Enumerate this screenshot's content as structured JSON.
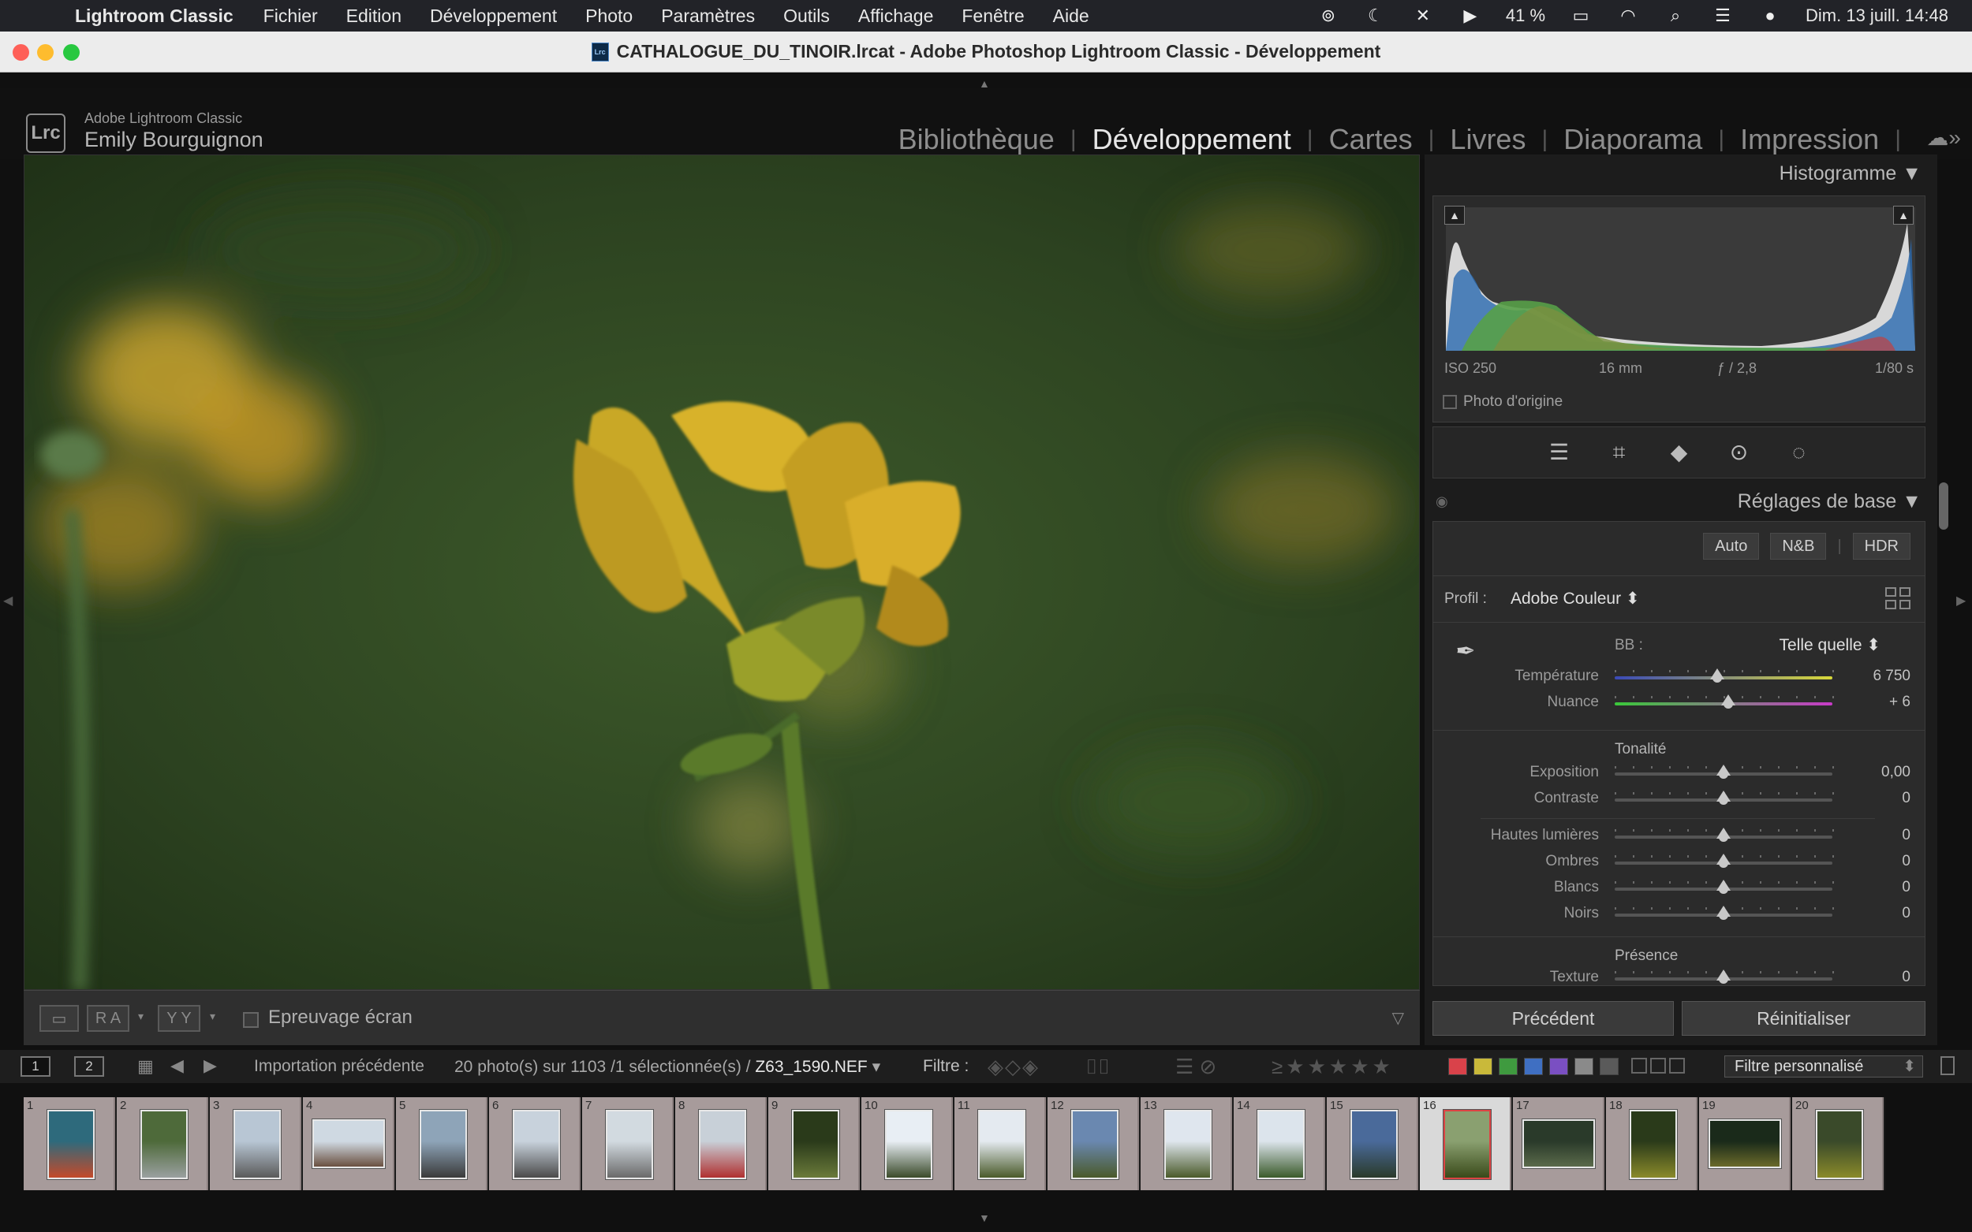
{
  "menubar": {
    "app_name": "Lightroom Classic",
    "items": [
      "Fichier",
      "Edition",
      "Développement",
      "Photo",
      "Paramètres",
      "Outils",
      "Affichage",
      "Fenêtre",
      "Aide"
    ],
    "battery": "41 %",
    "datetime": "Dim. 13 juill. 14:48"
  },
  "window": {
    "title": "CATHALOGUE_DU_TINOIR.lrcat - Adobe Photoshop Lightroom Classic - Développement"
  },
  "identity": {
    "logo": "Lrc",
    "product": "Adobe Lightroom Classic",
    "user": "Emily Bourguignon"
  },
  "modules": [
    {
      "label": "Bibliothèque",
      "active": false
    },
    {
      "label": "Développement",
      "active": true
    },
    {
      "label": "Cartes",
      "active": false
    },
    {
      "label": "Livres",
      "active": false
    },
    {
      "label": "Diaporama",
      "active": false
    },
    {
      "label": "Impression",
      "active": false
    }
  ],
  "histogram": {
    "title": "Histogramme",
    "iso": "ISO 250",
    "focal": "16 mm",
    "aperture": "ƒ / 2,8",
    "shutter": "1/80 s",
    "original_photo_label": "Photo d'origine"
  },
  "basic": {
    "title": "Réglages de base",
    "treatments": [
      "Auto",
      "N&B",
      "HDR"
    ],
    "profile_label": "Profil :",
    "profile_value": "Adobe Couleur",
    "wb_label": "BB :",
    "wb_value": "Telle quelle",
    "tone_title": "Tonalité",
    "presence_title": "Présence",
    "sliders": {
      "temperature": {
        "label": "Température",
        "value": "6 750",
        "pos": 0.47
      },
      "tint": {
        "label": "Nuance",
        "value": "+ 6",
        "pos": 0.52
      },
      "exposure": {
        "label": "Exposition",
        "value": "0,00",
        "pos": 0.5
      },
      "contrast": {
        "label": "Contraste",
        "value": "0",
        "pos": 0.5
      },
      "highlights": {
        "label": "Hautes lumières",
        "value": "0",
        "pos": 0.5
      },
      "shadows": {
        "label": "Ombres",
        "value": "0",
        "pos": 0.5
      },
      "whites": {
        "label": "Blancs",
        "value": "0",
        "pos": 0.5
      },
      "blacks": {
        "label": "Noirs",
        "value": "0",
        "pos": 0.5
      },
      "texture": {
        "label": "Texture",
        "value": "0",
        "pos": 0.5
      }
    }
  },
  "buttons": {
    "previous": "Précédent",
    "reset": "Réinitialiser"
  },
  "toolbar": {
    "ra": "R A",
    "yy": "Y Y",
    "softproof": "Epreuvage écran"
  },
  "filmstrip_bar": {
    "screen1": "1",
    "screen2": "2",
    "source": "Importation précédente",
    "count": "20 photo(s) sur 1103 /1 sélectionnée(s) /",
    "file": "Z63_1590.NEF",
    "filter_label": "Filtre :",
    "custom_filter": "Filtre personnalisé",
    "color_labels": [
      "#d9424a",
      "#c9b93a",
      "#3f9a3f",
      "#3f6fc2",
      "#7a4fc2",
      "#8a8a8a",
      "#5a5a5a"
    ]
  },
  "filmstrip": {
    "selected_index": 16,
    "thumbs": [
      {
        "n": "1",
        "orient": "p",
        "c1": "#2e6a7c",
        "c2": "#c44a2a"
      },
      {
        "n": "2",
        "orient": "p",
        "c1": "#4e6a3a",
        "c2": "#9aa0a0"
      },
      {
        "n": "3",
        "orient": "p",
        "c1": "#b8c6d4",
        "c2": "#5a5a5a"
      },
      {
        "n": "4",
        "orient": "l",
        "c1": "#cfd9e2",
        "c2": "#6a5040"
      },
      {
        "n": "5",
        "orient": "p",
        "c1": "#8ea4b8",
        "c2": "#3a3a3a"
      },
      {
        "n": "6",
        "orient": "p",
        "c1": "#c8d2dc",
        "c2": "#4a4a4a"
      },
      {
        "n": "7",
        "orient": "p",
        "c1": "#d2dae0",
        "c2": "#6a6a6a"
      },
      {
        "n": "8",
        "orient": "p",
        "c1": "#c8d0d8",
        "c2": "#b03030"
      },
      {
        "n": "9",
        "orient": "p",
        "c1": "#2a3a1a",
        "c2": "#6a7a3a"
      },
      {
        "n": "10",
        "orient": "p",
        "c1": "#e8eef4",
        "c2": "#3a4a2a"
      },
      {
        "n": "11",
        "orient": "p",
        "c1": "#e4eaf0",
        "c2": "#4a5a2a"
      },
      {
        "n": "12",
        "orient": "p",
        "c1": "#6a88b0",
        "c2": "#4a5a2a"
      },
      {
        "n": "13",
        "orient": "p",
        "c1": "#dfe6ee",
        "c2": "#4a5a2a"
      },
      {
        "n": "14",
        "orient": "p",
        "c1": "#dce4ec",
        "c2": "#3a5a2a"
      },
      {
        "n": "15",
        "orient": "p",
        "c1": "#4a6a9a",
        "c2": "#2a3a2a"
      },
      {
        "n": "16",
        "orient": "p",
        "c1": "#8aa070",
        "c2": "#3a4a1a"
      },
      {
        "n": "17",
        "orient": "l",
        "c1": "#2a3a2a",
        "c2": "#5a6a4a"
      },
      {
        "n": "18",
        "orient": "p",
        "c1": "#2a3a1a",
        "c2": "#8a8a2a"
      },
      {
        "n": "19",
        "orient": "l",
        "c1": "#1a2a1a",
        "c2": "#6a6a2a"
      },
      {
        "n": "20",
        "orient": "p",
        "c1": "#3a4a2a",
        "c2": "#8a8a2a"
      }
    ]
  }
}
